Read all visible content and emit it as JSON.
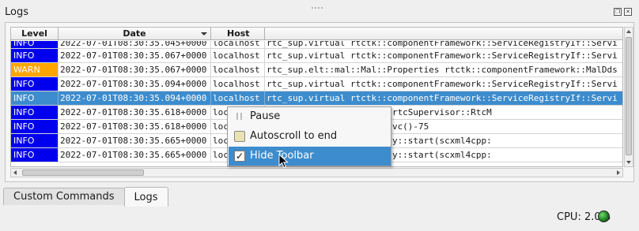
{
  "panel": {
    "title": "Logs"
  },
  "table": {
    "columns": [
      "Level",
      "Date",
      "Host",
      ""
    ],
    "rows": [
      {
        "level": "INFO",
        "date": "2022-07-01T08:30:35.045+0000",
        "host": "localhost",
        "message": "rtc_sup.virtual rtctk::componentFramework::ServiceRegistryIf::Servi"
      },
      {
        "level": "INFO",
        "date": "2022-07-01T08:30:35.067+0000",
        "host": "localhost",
        "message": "rtc_sup.virtual rtctk::componentFramework::ServiceRegistryIf::Servi"
      },
      {
        "level": "WARN",
        "date": "2022-07-01T08:30:35.067+0000",
        "host": "localhost",
        "message": "rtc_sup.elt::mal::Mal::Properties rtctk::componentFramework::MalDds"
      },
      {
        "level": "INFO",
        "date": "2022-07-01T08:30:35.094+0000",
        "host": "localhost",
        "message": "rtc_sup.virtual rtctk::componentFramework::ServiceRegistryIf::Servi"
      },
      {
        "level": "INFO",
        "date": "2022-07-01T08:30:35.094+0000",
        "host": "localhost",
        "message": "rtc_sup.virtual rtctk::componentFramework::ServiceRegistryIf::Servi"
      },
      {
        "level": "INFO",
        "date": "2022-07-01T08:30:35.618+0000",
        "host": "loc",
        "message": "::ThreadFunction(rtctk::rtcSupervisor::RtcM"
      },
      {
        "level": "INFO",
        "date": "2022-07-01T08:30:35.618+0000",
        "host": "loc",
        "message": "upervisor::RtcMonitor::svc()-75"
      },
      {
        "level": "INFO",
        "date": "2022-07-01T08:30:35.665+0000",
        "host": "loc",
        "message": "Framework::ThreadActivity::start(scxml4cpp:"
      },
      {
        "level": "INFO",
        "date": "2022-07-01T08:30:35.665+0000",
        "host": "loc",
        "message": "Framework::ThreadActivity::start(scxml4cpp:"
      }
    ],
    "selected_row": 4
  },
  "context_menu": {
    "items": [
      {
        "label": "Pause",
        "icon": "pause-icon"
      },
      {
        "label": "Autoscroll to end",
        "icon": "autoscroll-icon"
      },
      {
        "label": "Hide Toolbar",
        "icon": "checkbox-checked-icon",
        "checked": true
      }
    ],
    "highlighted": 2
  },
  "tabs": [
    {
      "label": "Custom Commands",
      "active": false
    },
    {
      "label": "Logs",
      "active": true
    }
  ],
  "status": {
    "cpu_label": "CPU: 2.0%"
  },
  "colors": {
    "info": "#0000ee",
    "warn": "#ffa500",
    "selection": "#3d8ccd",
    "led": "#1d7a1d"
  }
}
